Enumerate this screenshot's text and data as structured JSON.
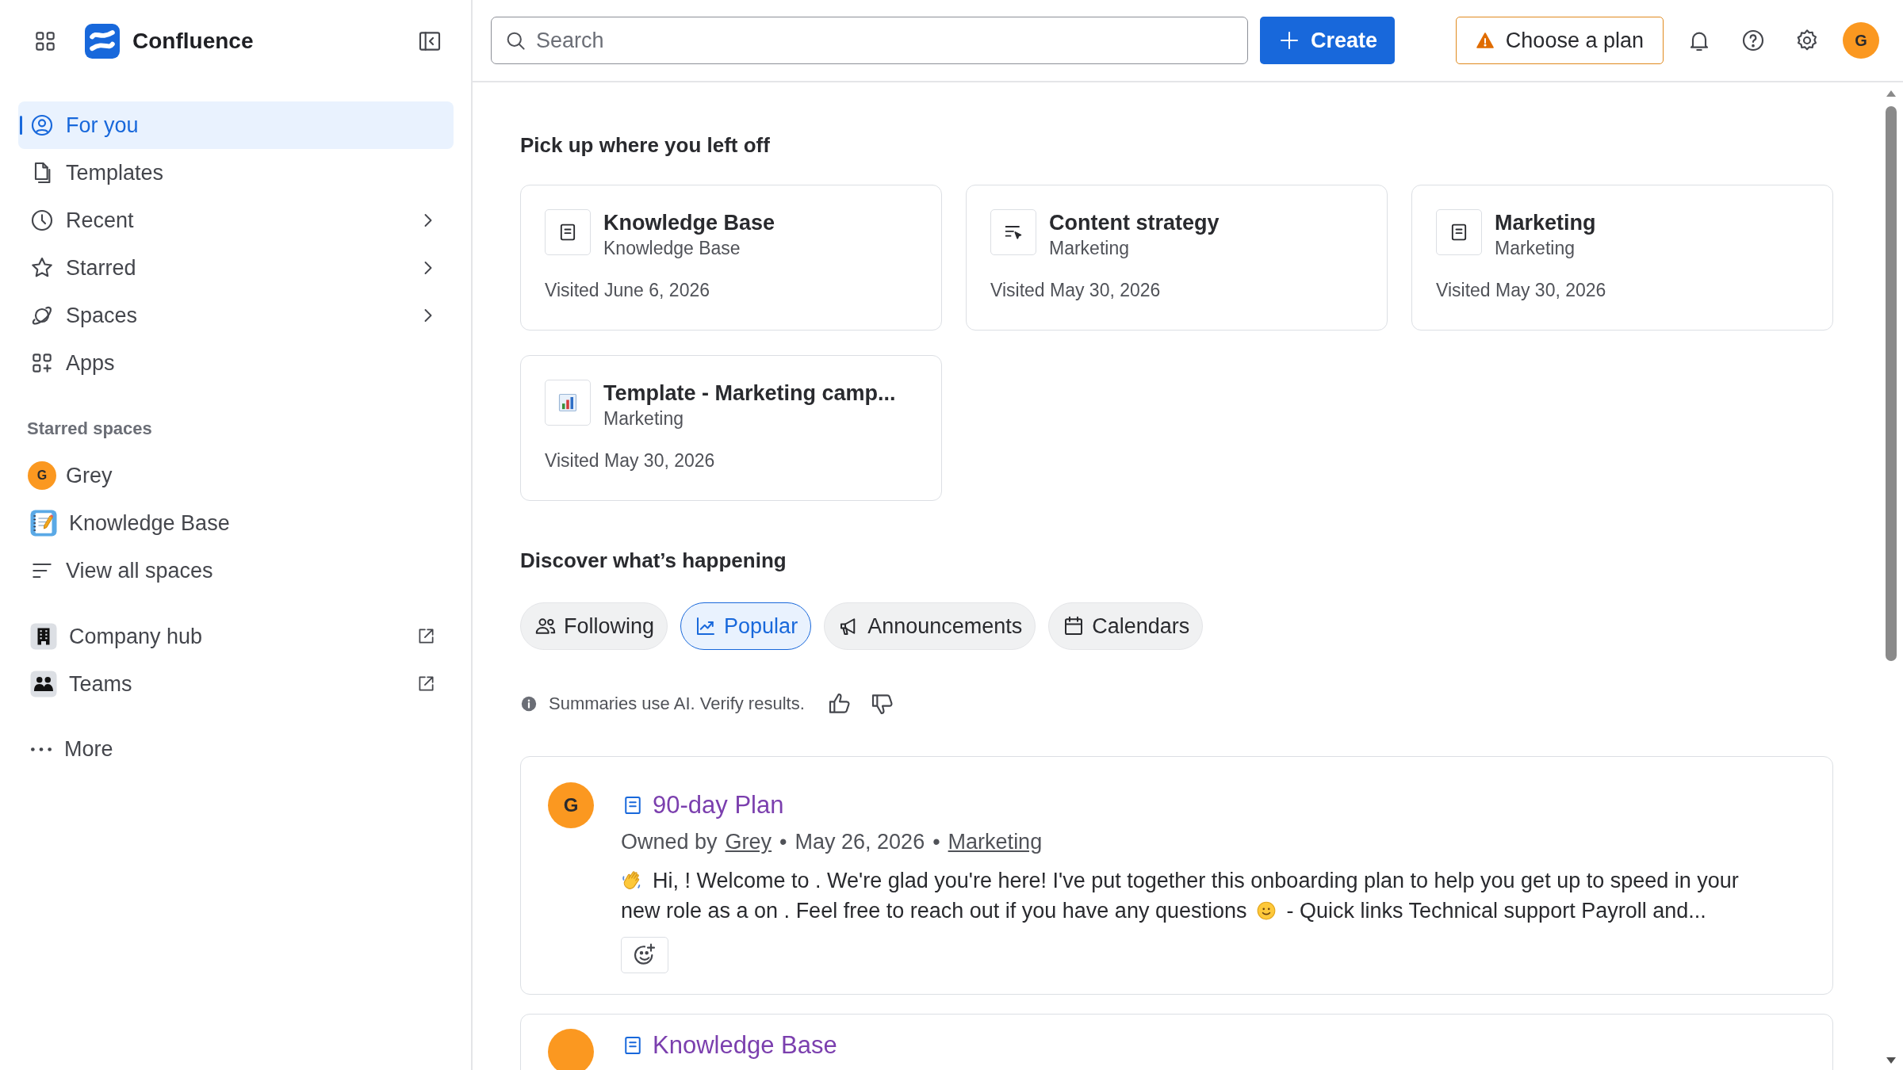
{
  "sidebar": {
    "app_name": "Confluence",
    "nav": [
      {
        "label": "For you",
        "selected": true,
        "kind": "plain"
      },
      {
        "label": "Templates",
        "selected": false,
        "kind": "plain"
      },
      {
        "label": "Recent",
        "selected": false,
        "kind": "submenu"
      },
      {
        "label": "Starred",
        "selected": false,
        "kind": "submenu"
      },
      {
        "label": "Spaces",
        "selected": false,
        "kind": "submenu"
      },
      {
        "label": "Apps",
        "selected": false,
        "kind": "plain"
      }
    ],
    "starred_spaces": {
      "heading": "Starred spaces",
      "items": [
        {
          "label": "Grey",
          "kind": "avatar",
          "avatar": "G"
        },
        {
          "label": "Knowledge Base",
          "kind": "notebook"
        },
        {
          "label": "View all spaces",
          "kind": "list"
        }
      ]
    },
    "links": [
      {
        "label": "Company hub",
        "external": true
      },
      {
        "label": "Teams",
        "external": true
      }
    ],
    "more": "More"
  },
  "top_bar": {
    "search": {
      "placeholder": "Search"
    },
    "create_button": "Create",
    "plan_button": "Choose a plan",
    "avatar": "G"
  },
  "recent": {
    "heading": "Pick up where you left off",
    "cards": [
      {
        "title": "Knowledge Base",
        "space": "Knowledge Base",
        "visited": "Visited June 6, 2026",
        "kind": "page"
      },
      {
        "title": "Content strategy",
        "space": "Marketing",
        "visited": "Visited May 30, 2026",
        "kind": "list"
      },
      {
        "title": "Marketing",
        "space": "Marketing",
        "visited": "Visited May 30, 2026",
        "kind": "page"
      },
      {
        "title": "Template - Marketing camp...",
        "space": "Marketing",
        "visited": "Visited May 30, 2026",
        "kind": "chart"
      }
    ]
  },
  "discover": {
    "heading": "Discover what’s happening",
    "filters": [
      {
        "label": "Following",
        "selected": false
      },
      {
        "label": "Popular",
        "selected": true
      },
      {
        "label": "Announcements",
        "selected": false
      },
      {
        "label": "Calendars",
        "selected": false
      }
    ],
    "ai_note": "Summaries use AI. Verify results."
  },
  "feed": [
    {
      "avatar": "G",
      "title": "90-day Plan",
      "owned_by": "Owned by",
      "owner": "Grey",
      "separators": [
        "•",
        "•"
      ],
      "date": "May 26, 2026",
      "space": "Marketing",
      "excerpt": [
        "Hi, ! Welcome to . We're glad you're here! I've put together this onboarding plan to help you get up to speed in your",
        "new role as a on . Feel free to reach out if you have any questions",
        "- Quick links Technical support Payroll and..."
      ]
    },
    {
      "title": "Knowledge Base"
    }
  ]
}
